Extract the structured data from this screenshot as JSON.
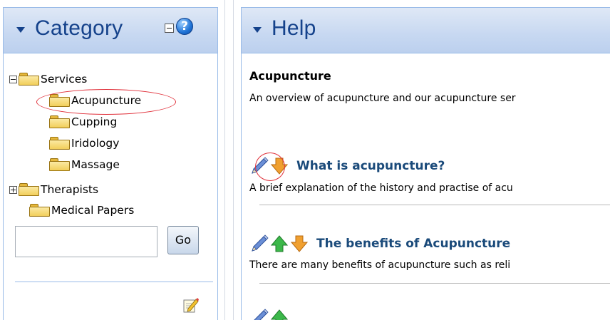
{
  "category_panel": {
    "title": "Category",
    "tree": [
      {
        "label": "Services",
        "expanded": true
      },
      {
        "label": "Acupuncture",
        "selected": true
      },
      {
        "label": "Cupping"
      },
      {
        "label": "Iridology"
      },
      {
        "label": "Massage"
      },
      {
        "label": "Therapists",
        "expanded": false
      },
      {
        "label": "Medical Papers"
      }
    ],
    "search": {
      "value": "",
      "placeholder": ""
    },
    "go_label": "Go"
  },
  "help_panel": {
    "title": "Help",
    "document": {
      "title": "Acupuncture",
      "description": "An overview of acupuncture and our acupuncture ser"
    },
    "articles": [
      {
        "title": "What is acupuncture?",
        "summary": "A brief explanation of the history and practise of acu"
      },
      {
        "title": "The benefits of Acupuncture",
        "summary": "There are many benefits of acupuncture such as reli"
      }
    ]
  },
  "colors": {
    "header_text": "#15428b",
    "panel_border": "#99bbe8",
    "article_title": "#1a4a7a",
    "highlight_oval": "#e0303a"
  },
  "icons": [
    "collapse-arrow-icon",
    "help-icon",
    "folder-icon",
    "pencil-edit-icon",
    "arrow-up-icon",
    "arrow-down-icon",
    "edit-note-icon"
  ]
}
